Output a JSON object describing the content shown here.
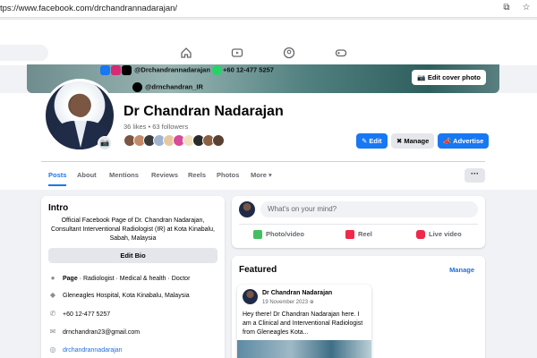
{
  "browser": {
    "url": "tps://www.facebook.com/drchandrannadarajan/"
  },
  "cover": {
    "handle1": "@Drchandrannadarajan",
    "phone": "+60 12-477 5257",
    "handle2": "@drnchandran_IR",
    "edit_label": "Edit cover photo"
  },
  "profile": {
    "name": "Dr Chandran Nadarajan",
    "stats": "36 likes • 63 followers",
    "edit_label": "Edit",
    "manage_label": "Manage",
    "advertise_label": "Advertise"
  },
  "tabs": [
    {
      "label": "Posts"
    },
    {
      "label": "About"
    },
    {
      "label": "Mentions"
    },
    {
      "label": "Reviews"
    },
    {
      "label": "Reels"
    },
    {
      "label": "Photos"
    },
    {
      "label": "More ▾"
    }
  ],
  "intro": {
    "title": "Intro",
    "bio": "Official Facebook Page of Dr. Chandran Nadarajan, Consultant Interventional Radiologist (IR) at Kota Kinabalu, Sabah, Malaysia",
    "edit_bio_label": "Edit Bio",
    "page_label": "Page",
    "page_categories": " · Radiologist · Medical & health · Doctor",
    "location": "Gleneagles Hospital, Kota Kinabalu, Malaysia",
    "phone": "+60 12-477 5257",
    "email": "drnchandran23@gmail.com",
    "instagram": "drchandrannadarajan"
  },
  "composer": {
    "placeholder": "What's on your mind?",
    "photo_label": "Photo/video",
    "reel_label": "Reel",
    "live_label": "Live video"
  },
  "featured": {
    "title": "Featured",
    "manage_label": "Manage",
    "post": {
      "author": "Dr Chandran Nadarajan",
      "date": "19 November 2023",
      "text": "Hey there! Dr Chandran Nadarajan here. I am a Clinical and Interventional Radiologist from Gleneagles Kota..."
    }
  },
  "colors": {
    "accent": "#1877f2",
    "link": "#216fdb",
    "muted": "#65676b"
  }
}
